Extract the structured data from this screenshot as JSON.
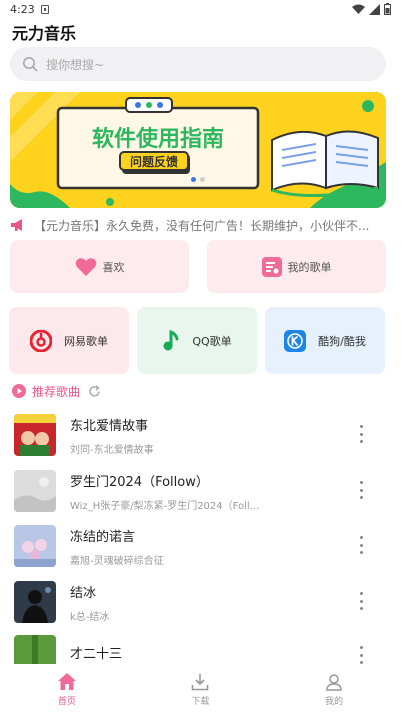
{
  "status": {
    "time": "4:23"
  },
  "app": {
    "title": "元力音乐"
  },
  "search": {
    "placeholder": "搜你想搜~"
  },
  "banner": {
    "title": "软件使用指南",
    "subtitle": "问题反馈"
  },
  "notice": {
    "text": "【元力音乐】永久免费，没有任何广告！长期维护，小伙伴不..."
  },
  "quick": [
    {
      "label": "喜欢",
      "icon": "heart-icon"
    },
    {
      "label": "我的歌单",
      "icon": "playlist-icon"
    }
  ],
  "platforms": [
    {
      "label": "网易歌单",
      "icon": "netease-icon",
      "bg": "#fde9ec"
    },
    {
      "label": "QQ歌单",
      "icon": "qq-music-icon",
      "bg": "#e8f6ee"
    },
    {
      "label": "酷狗/酷我",
      "icon": "kugou-icon",
      "bg": "#e7f1fb"
    }
  ],
  "recommend": {
    "label": "推荐歌曲"
  },
  "songs": [
    {
      "title": "东北爱情故事",
      "sub": "刘同-东北爱情故事"
    },
    {
      "title": "罗生门2024（Follow）",
      "sub": "Wiz_H张子豪/梨冻紧-罗生门2024（Foll..."
    },
    {
      "title": "冻结的诺言",
      "sub": "嘉旭-灵魂破碎综合征"
    },
    {
      "title": "结冰",
      "sub": "k总-结冰"
    },
    {
      "title": "才二十三",
      "sub": ""
    }
  ],
  "tabs": [
    {
      "label": "首页",
      "icon": "home-icon"
    },
    {
      "label": "下载",
      "icon": "download-icon"
    },
    {
      "label": "我的",
      "icon": "profile-icon"
    }
  ],
  "colors": {
    "accent": "#e9568a",
    "banner": "#ffd21e",
    "banner_green": "#2db85f"
  }
}
